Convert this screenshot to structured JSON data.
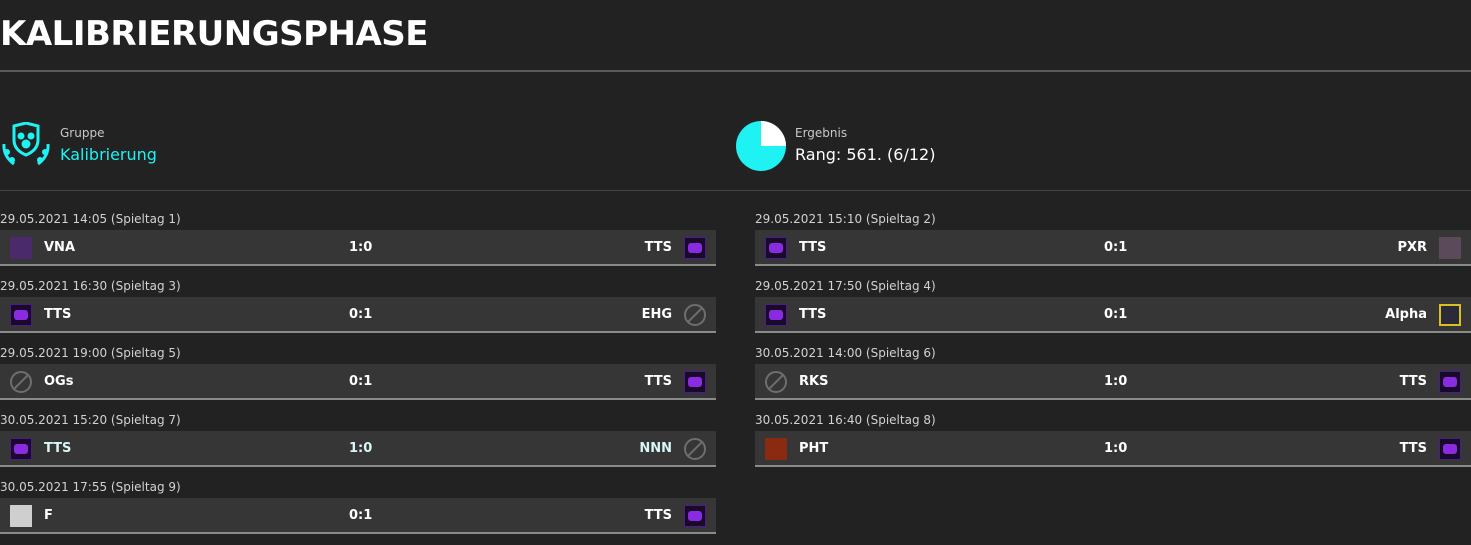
{
  "page": {
    "title": "KALIBRIERUNGSPHASE"
  },
  "group": {
    "label": "Gruppe",
    "value": "Kalibrierung"
  },
  "result": {
    "label": "Ergebnis",
    "value": "Rang: 561. (6/12)",
    "progress_fraction": 0.5
  },
  "colors": {
    "accent": "#1ef2f2",
    "background": "#222222",
    "row": "#363636"
  },
  "matches_left": [
    {
      "date": "29.05.2021 14:05 (Spieltag 1)",
      "home": "VNA",
      "score": "1:0",
      "away": "TTS",
      "home_logo": "vna-logo-icon",
      "away_logo": "tts-logo-icon"
    },
    {
      "date": "29.05.2021 16:30 (Spieltag 3)",
      "home": "TTS",
      "score": "0:1",
      "away": "EHG",
      "home_logo": "tts-logo-icon",
      "away_logo": "no-logo-icon"
    },
    {
      "date": "29.05.2021 19:00 (Spieltag 5)",
      "home": "OGs",
      "score": "0:1",
      "away": "TTS",
      "home_logo": "no-logo-icon",
      "away_logo": "tts-logo-icon"
    },
    {
      "date": "30.05.2021 15:20 (Spieltag 7)",
      "home": "TTS",
      "score": "1:0",
      "away": "NNN",
      "home_logo": "tts-logo-icon",
      "away_logo": "no-logo-icon"
    },
    {
      "date": "30.05.2021 17:55 (Spieltag 9)",
      "home": "F",
      "score": "0:1",
      "away": "TTS",
      "home_logo": "f-logo-icon",
      "away_logo": "tts-logo-icon"
    }
  ],
  "matches_right": [
    {
      "date": "29.05.2021 15:10 (Spieltag 2)",
      "home": "TTS",
      "score": "0:1",
      "away": "PXR",
      "home_logo": "tts-logo-icon",
      "away_logo": "pxr-logo-icon"
    },
    {
      "date": "29.05.2021 17:50 (Spieltag 4)",
      "home": "TTS",
      "score": "0:1",
      "away": "Alpha",
      "home_logo": "tts-logo-icon",
      "away_logo": "alpha-logo-icon"
    },
    {
      "date": "30.05.2021 14:00 (Spieltag 6)",
      "home": "RKS",
      "score": "1:0",
      "away": "TTS",
      "home_logo": "no-logo-icon",
      "away_logo": "tts-logo-icon"
    },
    {
      "date": "30.05.2021 16:40 (Spieltag 8)",
      "home": "PHT",
      "score": "1:0",
      "away": "TTS",
      "home_logo": "pht-logo-icon",
      "away_logo": "tts-logo-icon"
    }
  ]
}
